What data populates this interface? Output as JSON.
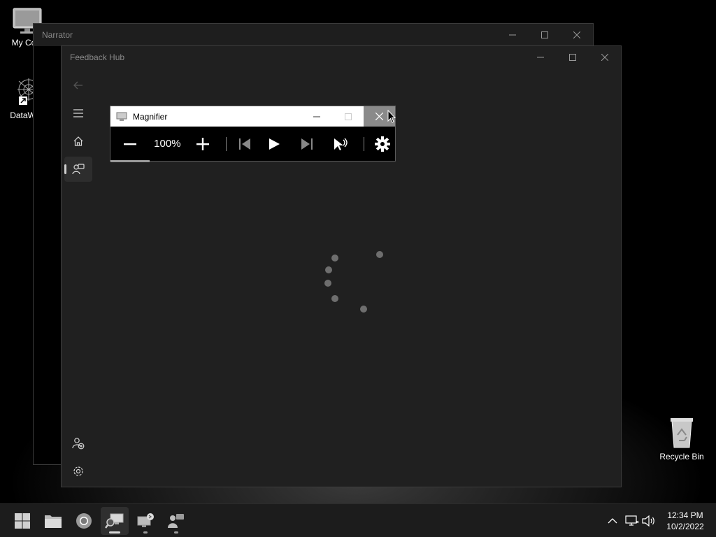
{
  "desktop": {
    "icons": [
      {
        "label": "My Com",
        "icon": "computer-icon"
      },
      {
        "label": "DataWag",
        "icon": "datawag-app-icon"
      },
      {
        "label": "Recycle Bin",
        "icon": "recycle-bin-icon"
      }
    ]
  },
  "narrator_window": {
    "title": "Narrator"
  },
  "feedback_hub_window": {
    "title": "Feedback Hub",
    "nav": [
      {
        "icon": "back-arrow-icon"
      },
      {
        "icon": "hamburger-menu-icon"
      },
      {
        "icon": "home-icon"
      },
      {
        "icon": "feedback-icon",
        "selected": true
      },
      {
        "icon": "add-account-icon"
      },
      {
        "icon": "settings-gear-icon"
      }
    ],
    "status": "loading"
  },
  "magnifier_window": {
    "title": "Magnifier",
    "zoom": "100%",
    "tools": [
      "zoom-out-icon",
      "zoom-in-icon",
      "previous-icon",
      "play-icon",
      "next-icon",
      "read-from-here-icon",
      "settings-icon"
    ]
  },
  "taskbar": {
    "apps": [
      {
        "icon": "start-windows-icon"
      },
      {
        "icon": "file-explorer-icon"
      },
      {
        "icon": "chrome-browser-icon"
      },
      {
        "icon": "magnifier-app-icon",
        "active": true
      },
      {
        "icon": "narrator-app-icon"
      },
      {
        "icon": "feedback-hub-app-icon"
      }
    ],
    "tray": [
      "show-hidden-icons-chevron",
      "network-icon",
      "volume-icon"
    ],
    "time": "12:34 PM",
    "date": "10/2/2022"
  }
}
